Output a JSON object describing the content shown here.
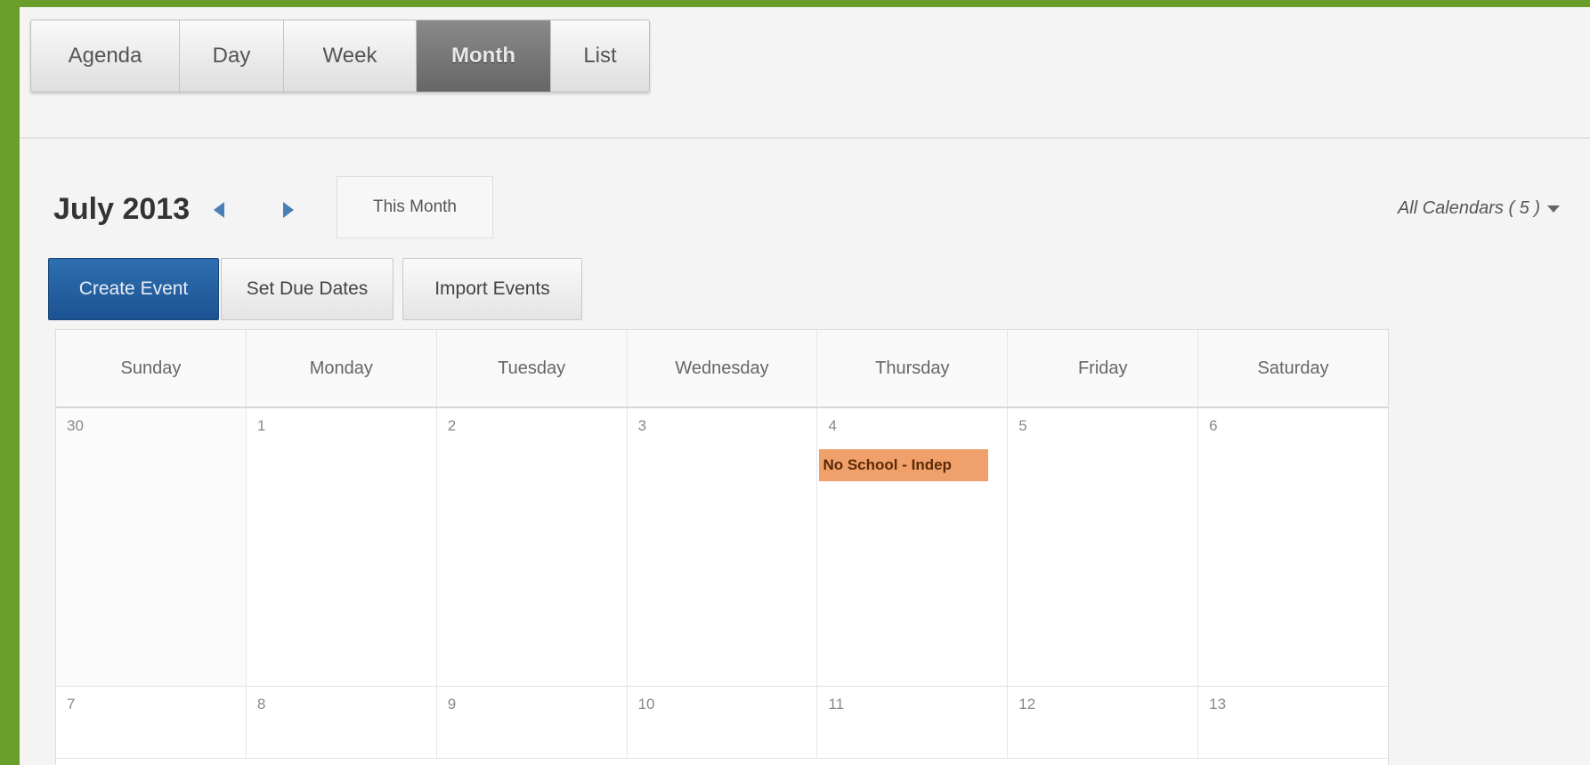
{
  "view_tabs": [
    "Agenda",
    "Day",
    "Week",
    "Month",
    "List"
  ],
  "active_view": "Month",
  "header": {
    "month_title": "July 2013",
    "this_month_label": "This Month",
    "all_calendars_label": "All Calendars ( 5 )"
  },
  "actions": {
    "create_event": "Create Event",
    "set_due_dates": "Set Due Dates",
    "import_events": "Import Events"
  },
  "weekdays": [
    "Sunday",
    "Monday",
    "Tuesday",
    "Wednesday",
    "Thursday",
    "Friday",
    "Saturday"
  ],
  "weeks": [
    [
      "30",
      "1",
      "2",
      "3",
      "4",
      "5",
      "6"
    ],
    [
      "7",
      "8",
      "9",
      "10",
      "11",
      "12",
      "13"
    ]
  ],
  "events": [
    {
      "title": "No School - Indep",
      "date": "4",
      "color": "#f0a06a"
    }
  ],
  "colors": {
    "frame_border": "#6a9e2a",
    "create_button": "#2f6fb0",
    "active_tab": "#777777",
    "event": "#f0a06a"
  }
}
